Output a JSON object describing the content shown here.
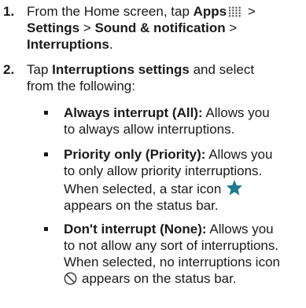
{
  "step1": {
    "number": "1.",
    "line1_pre": "From the Home screen, tap ",
    "line1_apps": "Apps",
    "line1_post": " >",
    "line2_settings": "Settings",
    "line2_sep1": " > ",
    "line2_sound": "Sound & notification",
    "line2_sep2": " >",
    "line3_interruptions": "Interruptions",
    "line3_end": "."
  },
  "step2": {
    "number": "2.",
    "line1_pre": "Tap ",
    "line1_bold": "Interruptions settings",
    "line1_post": " and select",
    "line2": "from the following:"
  },
  "options": [
    {
      "title": "Always interrupt (All):",
      "line1_rest": " Allows you",
      "line2": "to always allow interruptions."
    },
    {
      "title": "Priority only (Priority):",
      "line1_rest": " Allows you",
      "line2": "to only allow priority interruptions.",
      "line3": "When selected, a star icon",
      "line4": "appears on the status bar."
    },
    {
      "title": "Don't interrupt (None):",
      "line1_rest": " Allows you",
      "line2": "to not allow any sort of interruptions.",
      "line3": "When selected, no interruptions icon",
      "line4": "appears on the status bar."
    }
  ],
  "icons": {
    "apps": "apps-grid-icon",
    "star": "star-icon",
    "no_interruptions": "no-interruptions-icon",
    "star_color": "#1f7a8c",
    "apps_color": "#606060"
  }
}
